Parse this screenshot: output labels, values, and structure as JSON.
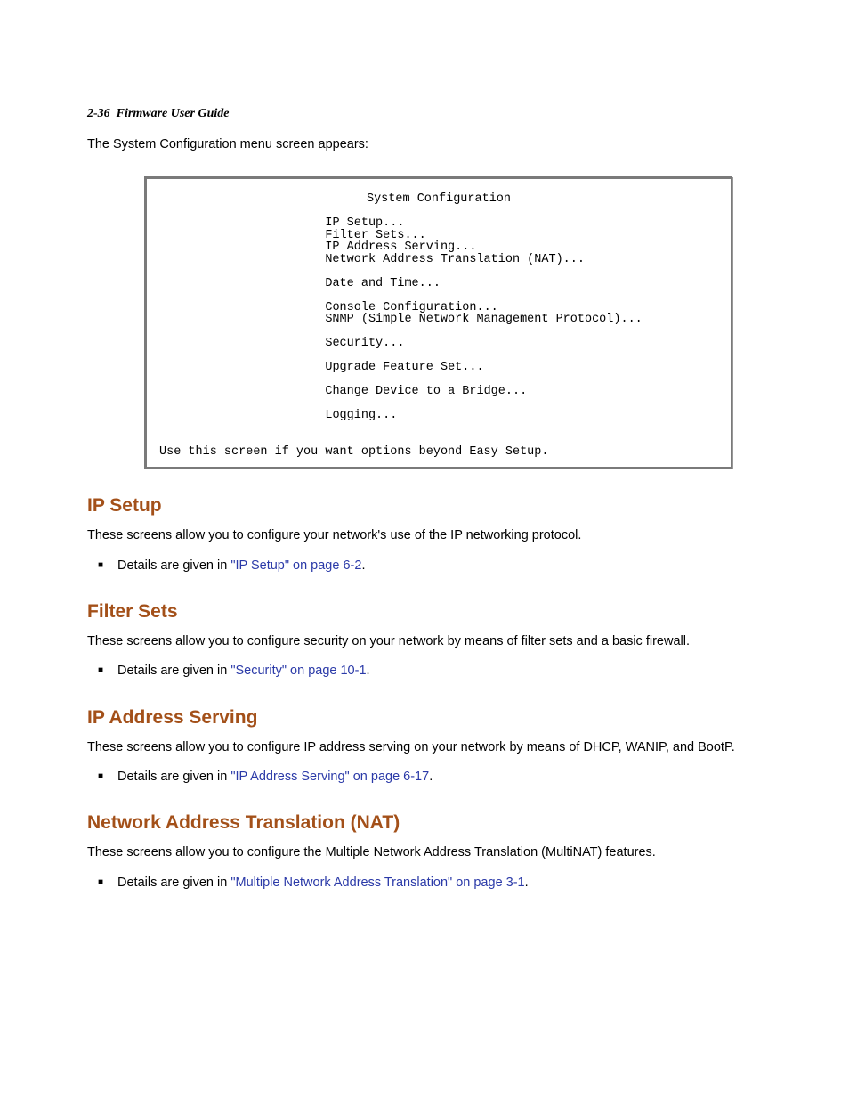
{
  "header": {
    "page_ref": "2-36",
    "guide_name": "Firmware User Guide"
  },
  "intro": "The System Configuration menu screen appears:",
  "terminal": {
    "title": "System Configuration",
    "block1": "IP Setup...\nFilter Sets...\nIP Address Serving...\nNetwork Address Translation (NAT)...",
    "block2": "Date and Time...",
    "block3": "Console Configuration...\nSNMP (Simple Network Management Protocol)...",
    "block4": "Security...",
    "block5": "Upgrade Feature Set...",
    "block6": "Change Device to a Bridge...",
    "block7": "Logging...",
    "hint": "Use this screen if you want options beyond Easy Setup."
  },
  "sections": {
    "ip_setup": {
      "title": "IP Setup",
      "body": "These screens allow you to configure your network's use of the IP networking protocol.",
      "bullet_pre": "Details are given in ",
      "link": "\"IP Setup\" on page 6-2",
      "bullet_post": "."
    },
    "filter_sets": {
      "title": "Filter Sets",
      "body": "These screens allow you to configure security on your network by means of filter sets and a basic firewall.",
      "bullet_pre": "Details are given in ",
      "link": "\"Security\" on page 10-1",
      "bullet_post": "."
    },
    "ip_addr_serving": {
      "title": "IP Address Serving",
      "body": "These screens allow you to configure IP address serving on your network by means of DHCP, WANIP, and BootP.",
      "bullet_pre": "Details are given in ",
      "link": "\"IP Address Serving\" on page 6-17",
      "bullet_post": "."
    },
    "nat": {
      "title": "Network Address Translation (NAT)",
      "body": "These screens allow you to configure the Multiple Network Address Translation (MultiNAT) features.",
      "bullet_pre": "Details are given in ",
      "link": "\"Multiple Network Address Translation\" on page 3-1",
      "bullet_post": "."
    }
  }
}
